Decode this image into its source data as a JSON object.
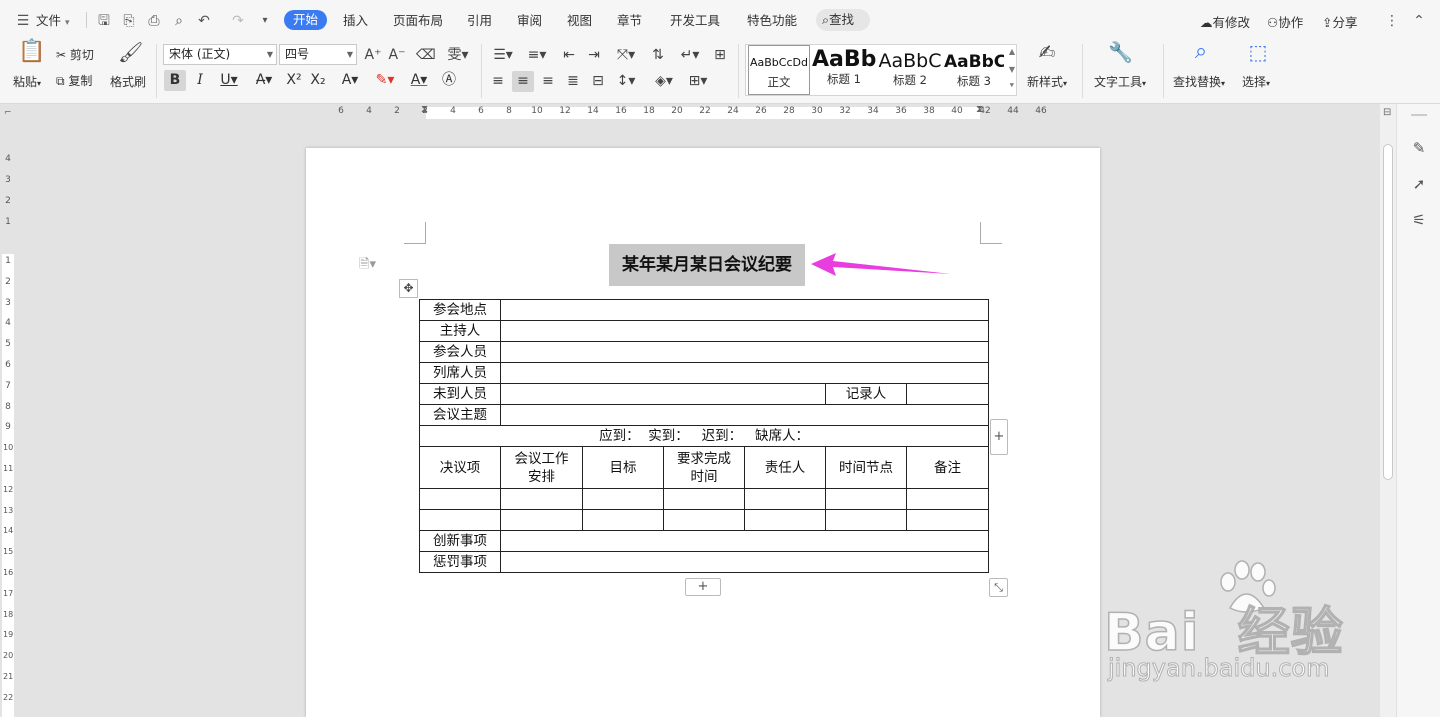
{
  "menu": {
    "file": "文件",
    "tabs": [
      "开始",
      "插入",
      "页面布局",
      "引用",
      "审阅",
      "视图",
      "章节",
      "开发工具",
      "特色功能"
    ],
    "active_tab": "开始",
    "search": "查找",
    "right": {
      "changes": "有修改",
      "collab": "协作",
      "share": "分享"
    }
  },
  "ribbon": {
    "paste": "粘贴",
    "cut": "剪切",
    "copy": "复制",
    "format_painter": "格式刷",
    "font_name": "宋体 (正文)",
    "font_size": "四号",
    "styles": [
      {
        "preview": "AaBbCcDd",
        "name": "正文"
      },
      {
        "preview": "AaBb",
        "name": "标题 1"
      },
      {
        "preview": "AaBbC",
        "name": "标题 2"
      },
      {
        "preview": "AaBbC",
        "name": "标题 3"
      }
    ],
    "new_style": "新样式",
    "text_tools": "文字工具",
    "find_replace": "查找替换",
    "select": "选择"
  },
  "ruler": {
    "h_ticks": [
      "6",
      "4",
      "2",
      "2",
      "4",
      "6",
      "8",
      "10",
      "12",
      "14",
      "16",
      "18",
      "20",
      "22",
      "24",
      "26",
      "28",
      "30",
      "32",
      "34",
      "36",
      "38",
      "40",
      "42",
      "44",
      "46"
    ],
    "v_ticks_top": [
      "4",
      "3",
      "2",
      "1"
    ],
    "v_ticks": [
      "1",
      "2",
      "3",
      "4",
      "5",
      "6",
      "7",
      "8",
      "9",
      "10",
      "11",
      "12",
      "13",
      "14",
      "15",
      "16",
      "17",
      "18",
      "19",
      "20",
      "21",
      "22"
    ]
  },
  "document": {
    "title": "某年某月某日会议纪要",
    "rows": {
      "location": "参会地点",
      "host": "主持人",
      "attendees": "参会人员",
      "observers": "列席人员",
      "absent": "未到人员",
      "recorder": "记录人",
      "topic": "会议主题",
      "attendance": "应到：  实到：   迟到：   缺席人：",
      "decision": "决议项",
      "work_plan": "会议工作安排",
      "goal": "目标",
      "deadline": "要求完成时间",
      "owner": "责任人",
      "milestone": "时间节点",
      "remark": "备注",
      "innovation": "创新事项",
      "penalty": "惩罚事项"
    }
  },
  "watermark": {
    "brand": "Bai  经验",
    "url": "jingyan.baidu.com"
  },
  "colors": {
    "accent": "#3a7bf2",
    "arrow": "#e83ee0"
  }
}
